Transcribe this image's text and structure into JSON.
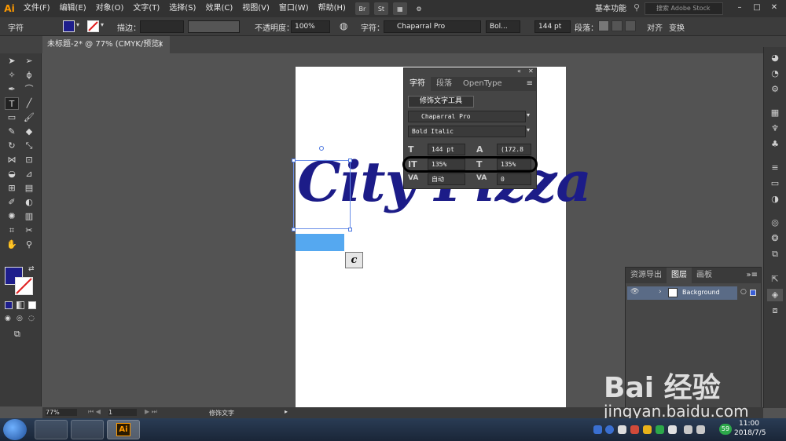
{
  "app": {
    "logo": "Ai",
    "workspace": "基本功能",
    "search_placeholder": "搜索 Adobe Stock"
  },
  "menu": [
    "文件(F)",
    "编辑(E)",
    "对象(O)",
    "文字(T)",
    "选择(S)",
    "效果(C)",
    "视图(V)",
    "窗口(W)",
    "帮助(H)"
  ],
  "menu_buttons": [
    "Br",
    "St"
  ],
  "controlbar": {
    "mode_label": "字符",
    "stroke_label": "描边：",
    "opacity_label": "不透明度：",
    "opacity_value": "100%",
    "font_label": "字符：",
    "font_name": "Chaparral Pro",
    "font_style": "Bol...",
    "font_size": "144 pt",
    "paragraph_label": "段落：",
    "align_label": "对齐",
    "transform_label": "变换"
  },
  "document": {
    "tab_title": "未标题-2* @ 77% (CMYK/预览)",
    "close": "×"
  },
  "canvas": {
    "text": "City Pizza",
    "tooltip_char": "c"
  },
  "character_panel": {
    "tabs": [
      "字符",
      "段落",
      "OpenType"
    ],
    "touch_type_button": "修饰文字工具",
    "font_family": "Chaparral Pro",
    "font_style": "Bold Italic",
    "font_size": "144 pt",
    "leading": "(172.8",
    "vertical_scale": "135%",
    "horizontal_scale": "135%",
    "kerning": "自动",
    "tracking": "0"
  },
  "layers_panel": {
    "tabs": [
      "资源导出",
      "图层",
      "画板"
    ],
    "layer_name": "Background"
  },
  "status": {
    "zoom": "77%",
    "page": "1",
    "tool": "修饰文字"
  },
  "taskbar": {
    "ai_label": "Ai",
    "time": "11:00",
    "date": "2018/7/5",
    "tray_number": "59"
  },
  "watermark": {
    "brand": "Bai 经验",
    "url": "jingyan.baidu.com"
  },
  "colors": {
    "text_fill": "#1c1c88",
    "accent": "#ff9a00",
    "selection": "#55a8f0"
  }
}
